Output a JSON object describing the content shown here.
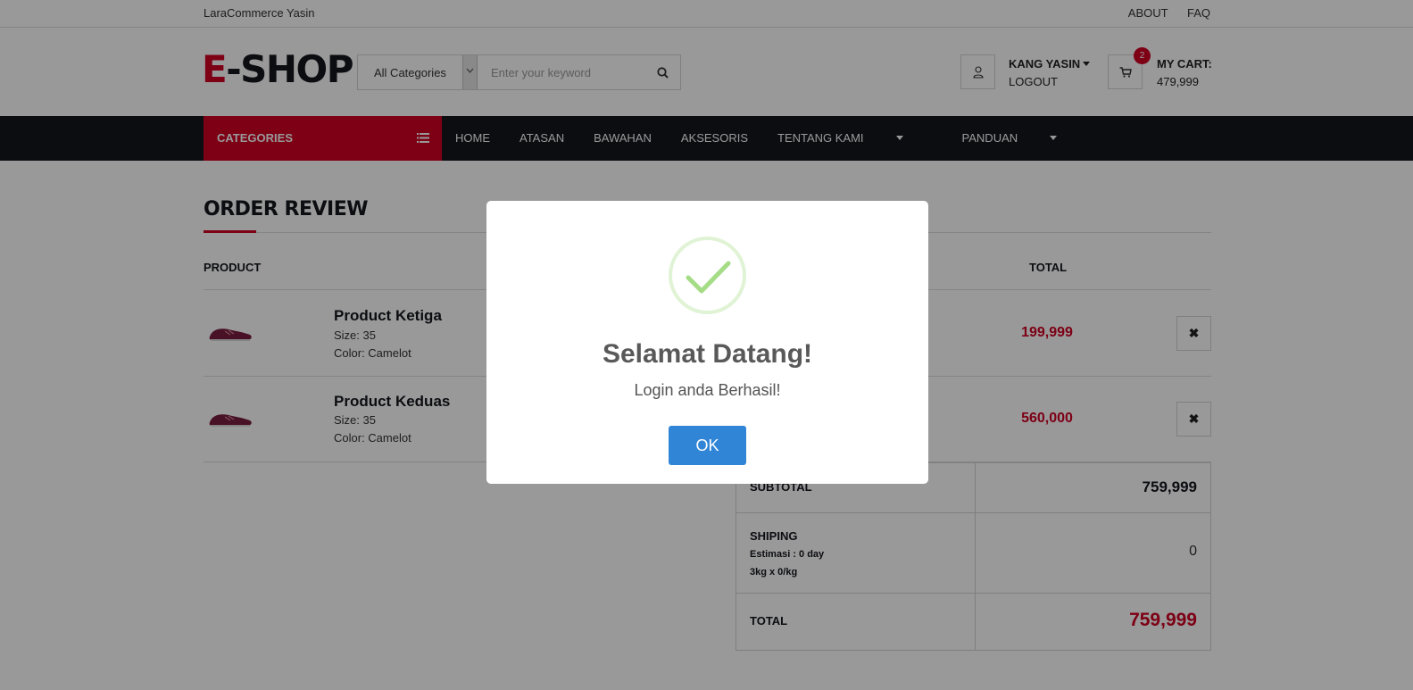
{
  "topbar": {
    "brand": "LaraCommerce Yasin",
    "links": [
      "ABOUT",
      "FAQ"
    ]
  },
  "header": {
    "logo_first": "E",
    "logo_rest": "-SHOP",
    "search": {
      "category": "All Categories",
      "placeholder": "Enter your keyword"
    },
    "account": {
      "name": "KANG YASIN",
      "action": "LOGOUT"
    },
    "cart": {
      "label": "MY CART:",
      "amount": "479,999",
      "count": "2"
    }
  },
  "nav": {
    "categories_label": "CATEGORIES",
    "items": [
      "HOME",
      "ATASAN",
      "BAWAHAN",
      "AKSESORIS",
      "TENTANG KAMI",
      "PANDUAN"
    ]
  },
  "order": {
    "title": "ORDER REVIEW",
    "headers": {
      "product": "PRODUCT",
      "total": "TOTAL"
    },
    "items": [
      {
        "name": "Product Ketiga",
        "size": "Size: 35",
        "color": "Color: Camelot",
        "total": "199,999"
      },
      {
        "name": "Product Keduas",
        "size": "Size: 35",
        "color": "Color: Camelot",
        "total": "560,000"
      }
    ],
    "delete_symbol": "✖",
    "summary": {
      "subtotal_label": "SUBTOTAL",
      "subtotal_value": "759,999",
      "shipping_label": "SHIPING",
      "shipping_est": "Estimasi : 0 day",
      "shipping_calc": "3kg x 0/kg",
      "shipping_value": "0",
      "total_label": "TOTAL",
      "total_value": "759,999"
    }
  },
  "modal": {
    "title": "Selamat Datang!",
    "text": "Login anda Berhasil!",
    "button": "OK"
  },
  "colors": {
    "accent": "#d10024",
    "dark": "#15161d",
    "ok_button": "#3085d6",
    "check": "#a5dc86"
  }
}
